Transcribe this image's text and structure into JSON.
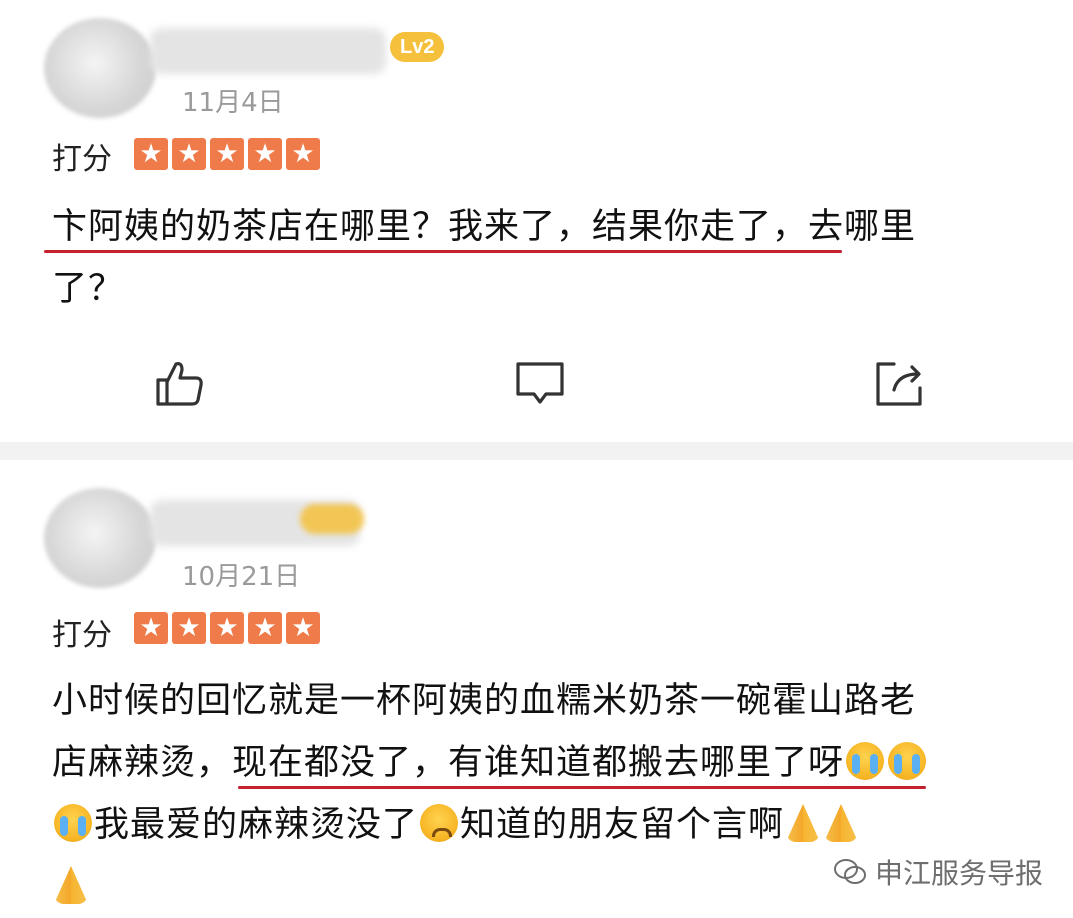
{
  "reviews": [
    {
      "level": "Lv2",
      "date": "11月4日",
      "rating_label": "打分",
      "stars": 5,
      "comment": {
        "line1": "卞阿姨的奶茶店在哪里？我来了，结果你走了，去哪里",
        "line2": "了？"
      }
    },
    {
      "date": "10月21日",
      "rating_label": "打分",
      "stars": 5,
      "comment": {
        "line1": "小时候的回忆就是一杯阿姨的血糯米奶茶一碗霍山路老",
        "line2": "店麻辣烫，现在都没了，有谁知道都搬去哪里了呀",
        "line3a": "我最爱的麻辣烫没了",
        "line3b": "知道的朋友留个言啊"
      }
    }
  ],
  "actions": {
    "like_icon": "thumbs-up-icon",
    "comment_icon": "comment-icon",
    "share_icon": "share-icon"
  },
  "watermark": {
    "text": "申江服务导报",
    "icon": "wechat-icon"
  },
  "colors": {
    "star": "#f07b4a",
    "badge": "#f5c13c",
    "underline": "#c4202e"
  }
}
